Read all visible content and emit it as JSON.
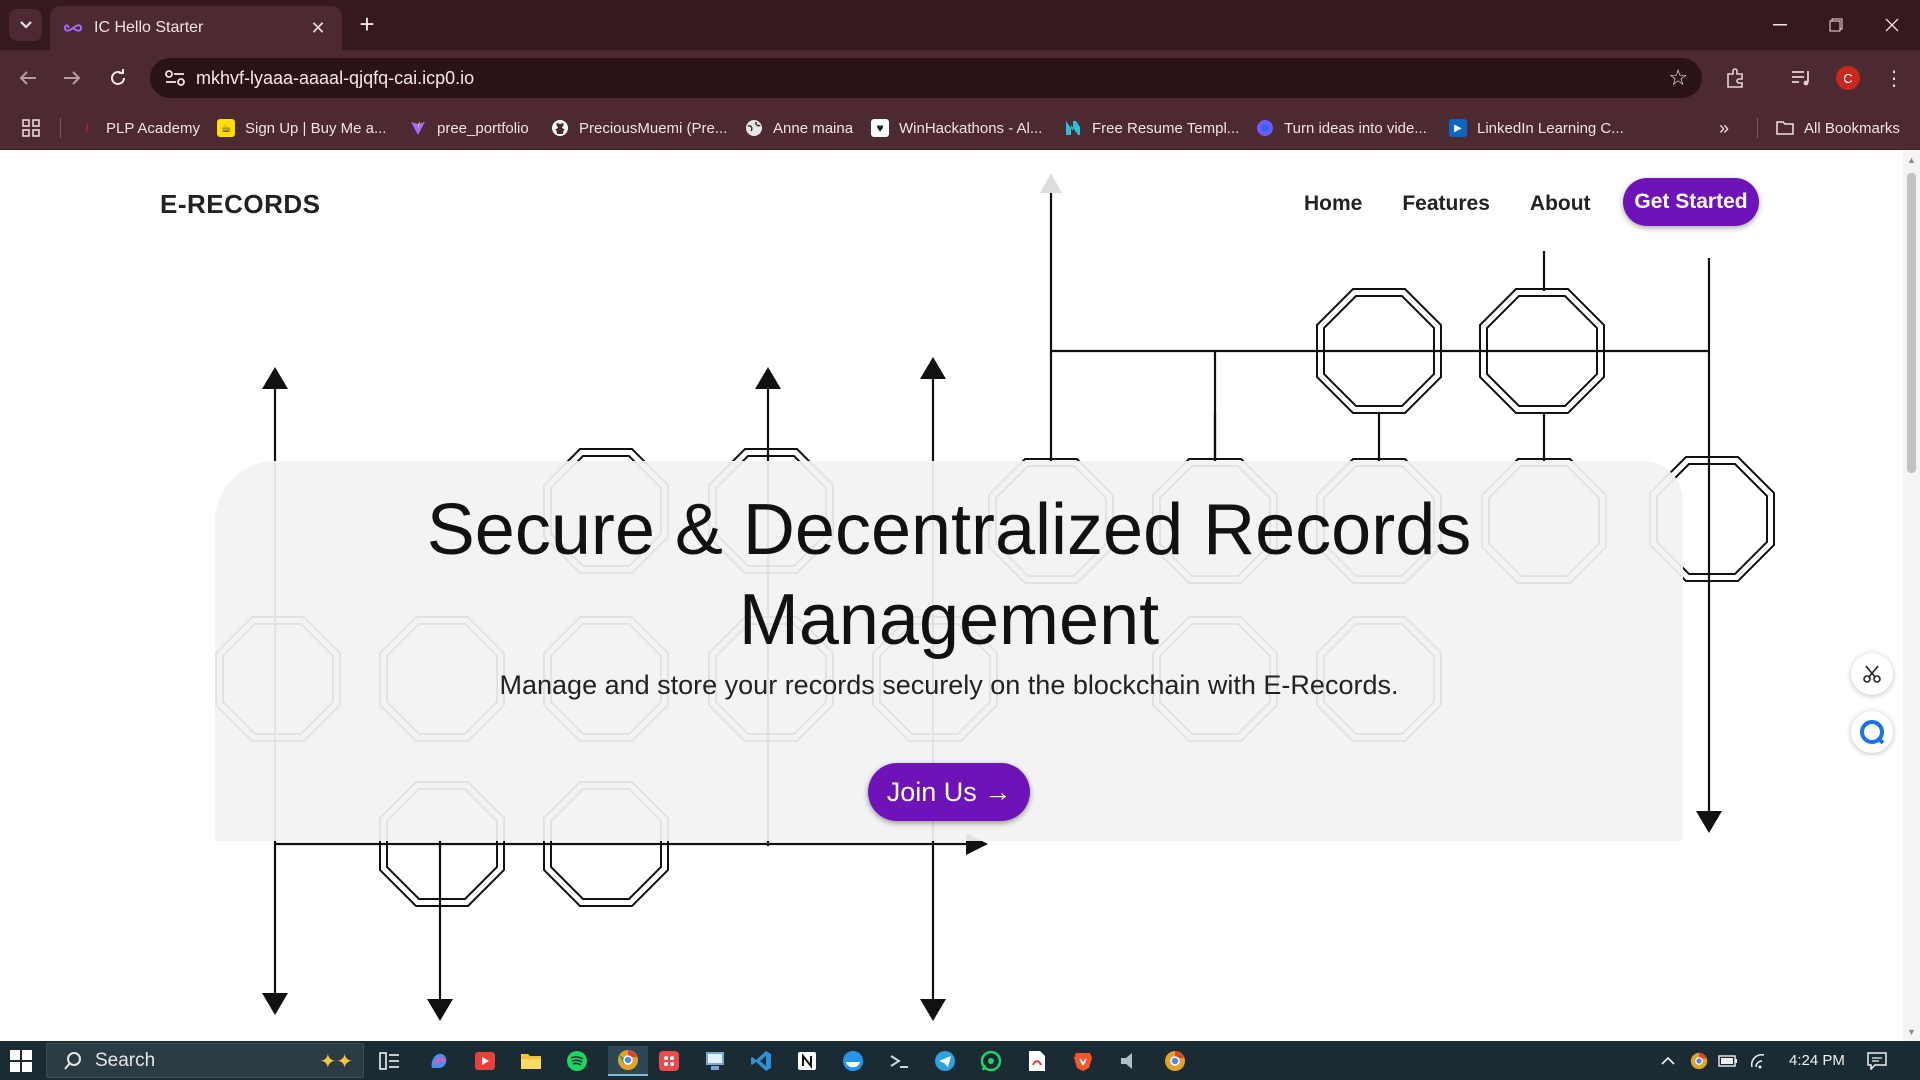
{
  "browser": {
    "tab_title": "IC Hello Starter",
    "url": "mkhvf-lyaaa-aaaal-qjqfq-cai.icp0.io",
    "profile_initial": "C",
    "bookmarks": [
      {
        "label": "PLP Academy",
        "icon": "plp-icon",
        "color": "#c2185b"
      },
      {
        "label": "Sign Up | Buy Me a...",
        "icon": "buymeacoffee-icon",
        "color": "#ffdd00"
      },
      {
        "label": "pree_portfolio",
        "icon": "vite-icon",
        "color": "#a46bff"
      },
      {
        "label": "PreciousMuemi (Pre...",
        "icon": "github-icon",
        "color": "#ffffff"
      },
      {
        "label": "Anne maina",
        "icon": "globe-icon",
        "color": "#e6e6e6"
      },
      {
        "label": "WinHackathons - Al...",
        "icon": "heart-icon",
        "color": "#ffffff"
      },
      {
        "label": "Free Resume Templ...",
        "icon": "novoresume-icon",
        "color": "#27c1d9"
      },
      {
        "label": "Turn ideas into vide...",
        "icon": "ai-video-icon",
        "color": "#6b5cff"
      },
      {
        "label": "LinkedIn Learning C...",
        "icon": "linkedin-learning-icon",
        "color": "#0a66c2"
      }
    ],
    "all_bookmarks": "All Bookmarks"
  },
  "page": {
    "brand": "E-RECORDS",
    "nav": {
      "home": "Home",
      "features": "Features",
      "about": "About"
    },
    "cta": "Get Started",
    "hero": {
      "title_line1": "Secure & Decentralized Records",
      "title_line2": "Management",
      "subtitle": "Manage and store your records securely on the blockchain with E-Records.",
      "join": "Join Us →"
    },
    "accent_color": "#6d13b8"
  },
  "taskbar": {
    "search_placeholder": "Search",
    "time": "4:24 PM"
  }
}
